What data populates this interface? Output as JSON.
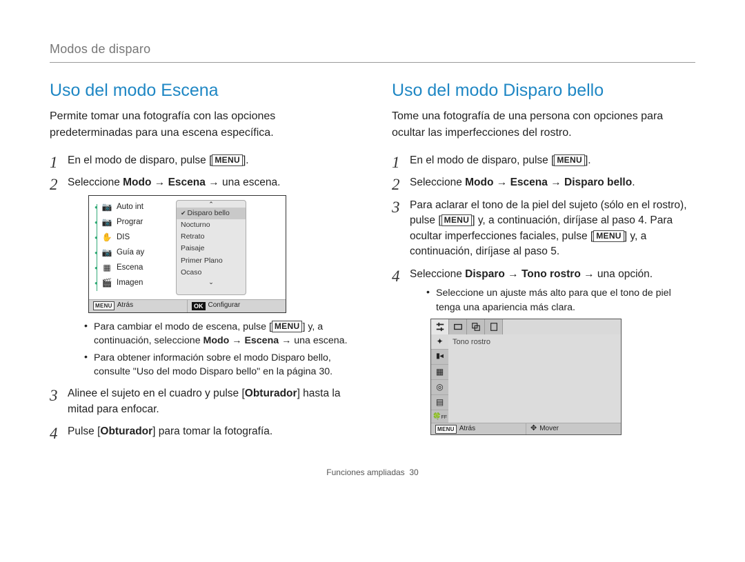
{
  "ui_labels": {
    "menu_key": "MENU",
    "ok_key": "OK"
  },
  "breadcrumb": "Modos de disparo",
  "left": {
    "heading": "Uso del modo Escena",
    "lead": "Permite tomar una fotografía con las opciones predeterminadas para una escena específica.",
    "step1_pre": "En el modo de disparo, pulse [",
    "step1_post": "].",
    "step2_a": "Seleccione ",
    "step2_b": "Modo",
    "step2_arrow": " → ",
    "step2_c": "Escena",
    "step2_d": " → una escena.",
    "bullet1_a": "Para cambiar el modo de escena, pulse [",
    "bullet1_b": "] y, a continuación, seleccione ",
    "bullet1_c": "Modo",
    "bullet1_d": "Escena",
    "bullet1_e": " → una escena.",
    "bullet2": "Para obtener información sobre el modo Disparo bello, consulte \"Uso del modo Disparo bello\" en la página 30.",
    "step3_a": "Alinee el sujeto en el cuadro y pulse [",
    "step3_b": "Obturador",
    "step3_c": "] hasta la mitad para enfocar.",
    "step4_a": "Pulse [",
    "step4_b": "Obturador",
    "step4_c": "] para tomar la fotografía.",
    "cam_left_items": [
      "Auto int",
      "Prograr",
      "DIS",
      "Guía ay",
      "Escena",
      "Imagen"
    ],
    "cam_popup_items": [
      "Disparo bello",
      "Nocturno",
      "Retrato",
      "Paisaje",
      "Primer Plano",
      "Ocaso"
    ],
    "cam_status_left": "Atrás",
    "cam_status_right": "Configurar"
  },
  "right": {
    "heading": "Uso del modo Disparo bello",
    "lead": "Tome una fotografía de una persona con opciones para ocultar las imperfecciones del rostro.",
    "step1_pre": "En el modo de disparo, pulse [",
    "step1_post": "].",
    "step2_a": "Seleccione ",
    "step2_b": "Modo",
    "step2_arrow": " → ",
    "step2_c": "Escena",
    "step2_d": "Disparo bello",
    "step2_dot": ".",
    "step3_a": "Para aclarar el tono de la piel del sujeto (sólo en el rostro), pulse [",
    "step3_b": "] y, a continuación, diríjase al paso 4. Para ocultar imperfecciones faciales, pulse [",
    "step3_c": "] y, a continuación, diríjase al paso 5.",
    "step4_a": "Seleccione ",
    "step4_b": "Disparo",
    "step4_c": "Tono rostro",
    "step4_d": " → una opción.",
    "bullet1": "Seleccione un ajuste más alto para que el tono de piel tenga una apariencia más clara.",
    "csb_label": "Tono rostro",
    "csb_status_left": "Atrás",
    "csb_status_right": "Mover"
  },
  "footer_label": "Funciones ampliadas",
  "footer_page": "30"
}
